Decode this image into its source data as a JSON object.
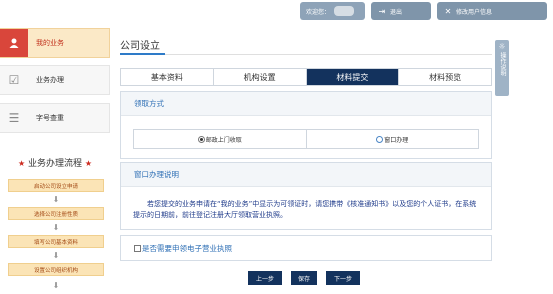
{
  "topbar": {
    "welcome": "欢迎您：",
    "logout": "退出",
    "modify_user": "修改用户信息"
  },
  "sidebar": {
    "items": [
      {
        "label": "我的业务",
        "icon": "user-icon"
      },
      {
        "label": "业务办理",
        "icon": "checkbox-icon"
      },
      {
        "label": "字号查重",
        "icon": "list-icon"
      }
    ],
    "flow_title": "业务办理流程",
    "flow_steps": [
      "启动公司设立申请",
      "选择公司注册性质",
      "填写公司基本资料",
      "设置公司组织机构"
    ]
  },
  "page": {
    "title": "公司设立"
  },
  "tabs": [
    "基本资料",
    "机构设置",
    "材料提交",
    "材料预览"
  ],
  "active_tab": "材料提交",
  "pickup": {
    "heading": "领取方式",
    "options": [
      "邮政上门收取",
      "窗口办理"
    ],
    "selected": "邮政上门收取"
  },
  "window_notice": {
    "heading": "窗口办理说明",
    "text": "若您提交的业务申请在“我的业务”中显示为可领证时，请您携带《核准通知书》以及您的个人证书，在系统提示的日期前，前往登记注册大厅领取营业执照。"
  },
  "license_option": {
    "label": "是否需要申领电子营业执照",
    "checked": false
  },
  "buttons": {
    "prev": "上一步",
    "save": "保存",
    "next": "下一步"
  },
  "float_panel": {
    "label": "操作说明"
  },
  "colors": {
    "accent_red": "#d9463b",
    "tab_active": "#13325d",
    "link_blue": "#2e6fb5"
  }
}
